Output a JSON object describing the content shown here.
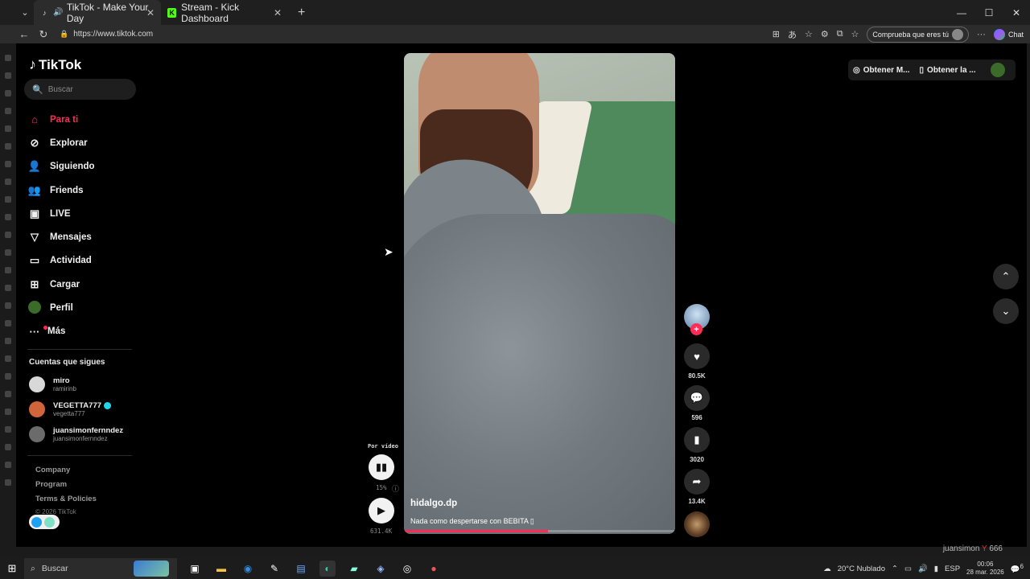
{
  "browser": {
    "tabs": [
      {
        "title": "TikTok - Make Your Day",
        "active": true
      },
      {
        "title": "Stream - Kick Dashboard",
        "active": false
      }
    ],
    "url": "https://www.tiktok.com",
    "verify_label": "Comprueba que eres tú",
    "chat_label": "Chat"
  },
  "sidebar": {
    "brand": "TikTok",
    "search_placeholder": "Buscar",
    "items": [
      {
        "label": "Para ti",
        "icon": "home-icon"
      },
      {
        "label": "Explorar",
        "icon": "compass-icon"
      },
      {
        "label": "Siguiendo",
        "icon": "user-follow-icon"
      },
      {
        "label": "Friends",
        "icon": "friends-icon"
      },
      {
        "label": "LIVE",
        "icon": "live-icon"
      },
      {
        "label": "Mensajes",
        "icon": "send-icon"
      },
      {
        "label": "Actividad",
        "icon": "activity-icon"
      },
      {
        "label": "Cargar",
        "icon": "upload-icon"
      },
      {
        "label": "Perfil",
        "icon": "avatar"
      },
      {
        "label": "Más",
        "icon": "more-icon"
      }
    ],
    "following_title": "Cuentas que sigues",
    "following": [
      {
        "name": "miro",
        "handle": "ramirinb"
      },
      {
        "name": "VEGETTA777",
        "handle": "vegetta777"
      },
      {
        "name": "juansimonfernndez",
        "handle": "juansimonfernndez"
      }
    ],
    "footer": [
      "Company",
      "Program",
      "Terms & Policies"
    ],
    "copyright": "© 2026 TikTok"
  },
  "video": {
    "author": "hidalgo.dp",
    "description": "Nada como despertarse con BEBITA ▯",
    "progress": 0.53
  },
  "player_side": {
    "label": "Por vídeo",
    "speed_pct": "15%",
    "views": "631.4K"
  },
  "actions": {
    "likes": "80.5K",
    "comments": "596",
    "saves": "3020",
    "shares": "13.4K"
  },
  "topright": {
    "coins": "Obtener M...",
    "app": "Obtener la ..."
  },
  "taskbar": {
    "search": "Buscar",
    "weather": "20°C  Nublado",
    "lang": "ESP",
    "time": "00:06",
    "date": "28 mar. 2026",
    "notif": "6",
    "stream_user": "juansimon",
    "stream_count": "666"
  },
  "colors": {
    "accent": "#fe2c55",
    "bg": "#000000"
  }
}
